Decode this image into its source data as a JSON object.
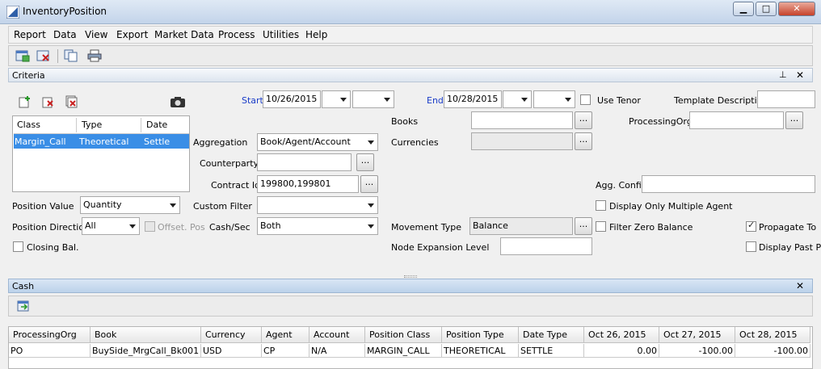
{
  "window": {
    "title": "InventoryPosition",
    "min_glyph": "▁",
    "max_glyph": "□",
    "close_glyph": "✕"
  },
  "menu": [
    "Report",
    "Data",
    "View",
    "Export",
    "Market Data",
    "Process",
    "Utilities",
    "Help"
  ],
  "criteria": {
    "title": "Criteria",
    "pin_glyph": "⊥",
    "close_glyph": "✕",
    "start_label": "Start",
    "start_value": "10/26/2015",
    "end_label": "End",
    "end_value": "10/28/2015",
    "use_tenor_label": "Use Tenor",
    "template_description_label": "Template Description",
    "class_list": {
      "headers": [
        "Class",
        "Type",
        "Date"
      ],
      "row": [
        "Margin_Call",
        "Theoretical",
        "Settle"
      ]
    },
    "aggregation_label": "Aggregation",
    "aggregation_value": "Book/Agent/Account",
    "counterparty_label": "Counterparty",
    "contract_id_label": "Contract Id",
    "contract_id_value": "199800,199801",
    "custom_filter_label": "Custom Filter",
    "cash_sec_label": "Cash/Sec",
    "cash_sec_value": "Both",
    "books_label": "Books",
    "currencies_label": "Currencies",
    "processing_org_label": "ProcessingOrg",
    "agg_config_label": "Agg. Config",
    "position_value_label": "Position Value",
    "position_value_value": "Quantity",
    "position_direction_label": "Position Direction",
    "position_direction_value": "All",
    "offset_pos_label": "Offset. Pos",
    "closing_bal_label": "Closing Bal.",
    "display_only_multiple_agent_label": "Display Only Multiple Agent",
    "movement_type_label": "Movement Type",
    "movement_type_value": "Balance",
    "filter_zero_balance_label": "Filter Zero Balance",
    "propagate_to_label": "Propagate To",
    "node_expansion_label": "Node Expansion Level",
    "display_past_label": "Display Past P",
    "dots": "..."
  },
  "cash": {
    "title": "Cash",
    "close_glyph": "✕",
    "columns": [
      "ProcessingOrg",
      "Book",
      "Currency",
      "Agent",
      "Account",
      "Position Class",
      "Position Type",
      "Date Type",
      "Oct 26, 2015",
      "Oct 27, 2015",
      "Oct 28, 2015"
    ],
    "row": [
      "PO",
      "BuySide_MrgCall_Bk001",
      "USD",
      "CP",
      "N/A",
      "MARGIN_CALL",
      "THEORETICAL",
      "SETTLE",
      "0.00",
      "-100.00",
      "-100.00"
    ]
  },
  "colors": {
    "selection": "#3a8ee6",
    "link_blue": "#1a3cc8"
  }
}
